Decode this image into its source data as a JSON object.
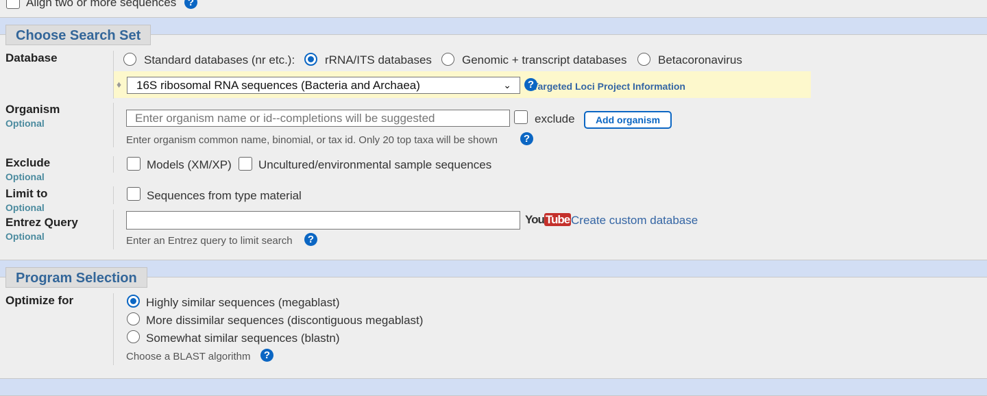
{
  "top": {
    "align_label": "Align two or more sequences",
    "help_icon": "question-circle-icon"
  },
  "search_set": {
    "title": "Choose Search Set",
    "database": {
      "label": "Database",
      "options": [
        "Standard databases (nr etc.):",
        "rRNA/ITS databases",
        "Genomic + transcript databases",
        "Betacoronavirus"
      ],
      "selected": "rRNA/ITS databases",
      "select_value": "16S ribosomal RNA sequences (Bacteria and Archaea)",
      "info_link": "Targeted Loci Project Information"
    },
    "organism": {
      "label": "Organism",
      "optional": "Optional",
      "placeholder": "Enter organism name or id--completions will be suggested",
      "exclude_label": "exclude",
      "add_button": "Add organism",
      "hint": "Enter organism common name, binomial, or tax id. Only 20 top taxa will be shown"
    },
    "exclude": {
      "label": "Exclude",
      "optional": "Optional",
      "models": "Models (XM/XP)",
      "uncultured": "Uncultured/environmental sample sequences"
    },
    "limit": {
      "label": "Limit to",
      "optional": "Optional",
      "type_material": "Sequences from type material"
    },
    "entrez": {
      "label": "Entrez Query",
      "optional": "Optional",
      "value": "",
      "youtube": "YouTube",
      "custom_db": "Create custom database",
      "hint": "Enter an Entrez query to limit search"
    }
  },
  "program": {
    "title": "Program Selection",
    "label": "Optimize for",
    "options": [
      "Highly similar sequences (megablast)",
      "More dissimilar sequences (discontiguous megablast)",
      "Somewhat similar sequences (blastn)"
    ],
    "selected": "Highly similar sequences (megablast)",
    "hint": "Choose a BLAST algorithm"
  },
  "colors": {
    "band": "#d2def4",
    "header_text": "#336699",
    "accent": "#0b66c3",
    "highlight": "#fdf8cc"
  }
}
